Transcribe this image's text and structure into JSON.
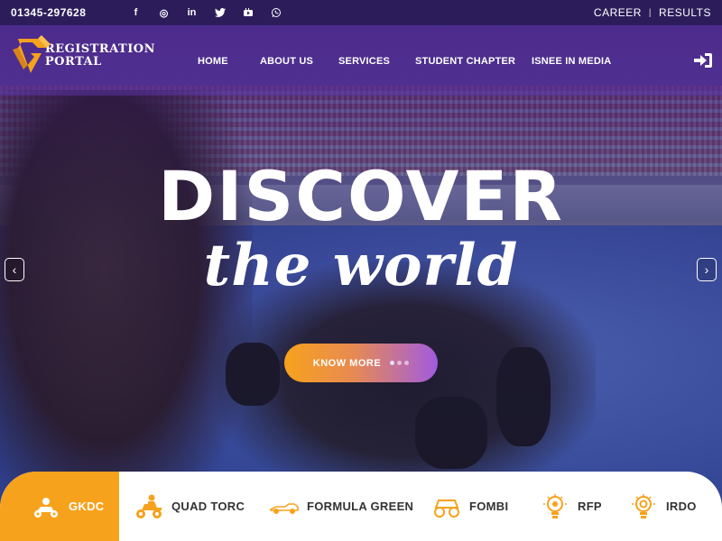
{
  "topbar": {
    "phone": "01345-297628",
    "socials": [
      {
        "icon": "facebook-icon",
        "glyph": "f"
      },
      {
        "icon": "instagram-icon",
        "glyph": "◎"
      },
      {
        "icon": "linkedin-icon",
        "glyph": "in"
      },
      {
        "icon": "twitter-icon",
        "glyph": "🐦"
      },
      {
        "icon": "youtube-icon",
        "glyph": "▶"
      },
      {
        "icon": "whatsapp-icon",
        "glyph": "✆"
      }
    ],
    "links": [
      "CAREER",
      "RESULTS"
    ],
    "separator": "|"
  },
  "header": {
    "logo": {
      "line1": "REGISTRATION",
      "line2": "PORTAL"
    },
    "nav": [
      "HOME",
      "ABOUT US",
      "SERVICES",
      "STUDENT CHAPTER",
      "ISNEE IN MEDIA"
    ],
    "login_icon": "sign-in-icon"
  },
  "hero": {
    "headline": "DISCOVER",
    "subline": "the world",
    "cta_label": "KNOW MORE",
    "prev_glyph": "‹",
    "next_glyph": "›"
  },
  "categories": [
    {
      "label": "GKDC",
      "icon": "go-kart-icon",
      "active": true
    },
    {
      "label": "QUAD TORC",
      "icon": "quad-bike-icon",
      "active": false
    },
    {
      "label": "FORMULA GREEN",
      "icon": "formula-car-icon",
      "active": false
    },
    {
      "label": "FOMBI",
      "icon": "buggy-icon",
      "active": false
    },
    {
      "label": "RFP",
      "icon": "lightbulb-icon",
      "active": false
    },
    {
      "label": "IRDO",
      "icon": "lightbulb-gear-icon",
      "active": false
    }
  ],
  "colors": {
    "topbar": "#2c1d5a",
    "accent_orange": "#f7a21c",
    "accent_purple": "#a15be0",
    "logo_orange": "#f7a21c"
  }
}
